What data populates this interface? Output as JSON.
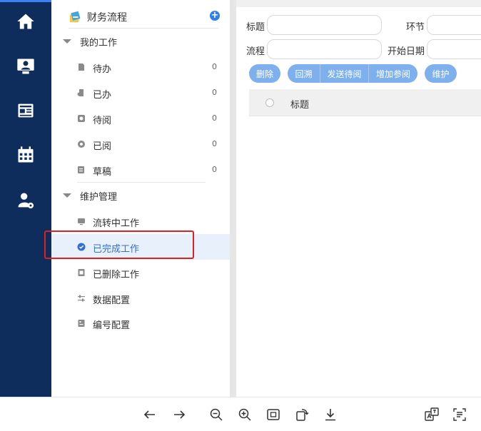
{
  "sidebar": {
    "header_title": "财务流程",
    "add_symbol": "+",
    "groups": [
      {
        "label": "我的工作",
        "items": [
          {
            "label": "待办",
            "count": "0"
          },
          {
            "label": "已办",
            "count": "0"
          },
          {
            "label": "待阅",
            "count": "0"
          },
          {
            "label": "已阅",
            "count": "0"
          },
          {
            "label": "草稿",
            "count": "0"
          }
        ]
      },
      {
        "label": "维护管理",
        "items": [
          {
            "label": "流转中工作"
          },
          {
            "label": "已完成工作"
          },
          {
            "label": "已删除工作"
          },
          {
            "label": "数据配置"
          },
          {
            "label": "编号配置"
          }
        ]
      }
    ],
    "active_item": "已完成工作"
  },
  "main": {
    "filters": {
      "title_label": "标题",
      "stage_label": "环节",
      "flow_label": "流程",
      "start_date_label": "开始日期"
    },
    "buttons": {
      "delete": "删除",
      "rollback": "回溯",
      "send_pending": "发送待阅",
      "add_reference": "增加参阅",
      "maintain": "维护"
    },
    "table": {
      "columns": [
        "标题"
      ]
    }
  },
  "colors": {
    "rail": "#0e2d5c",
    "accent": "#2f80ed",
    "button": "#7fb0ee",
    "highlight_box": "#e02020"
  },
  "rail_icons": [
    "home-icon",
    "monitor-user-icon",
    "news-icon",
    "calendar-icon",
    "user-settings-icon"
  ],
  "toolbar_icons": [
    "arrow-left-icon",
    "arrow-right-icon",
    "zoom-out-icon",
    "zoom-in-icon",
    "fit-screen-icon",
    "rotate-icon",
    "download-icon",
    "translate-icon",
    "text-extract-icon"
  ]
}
